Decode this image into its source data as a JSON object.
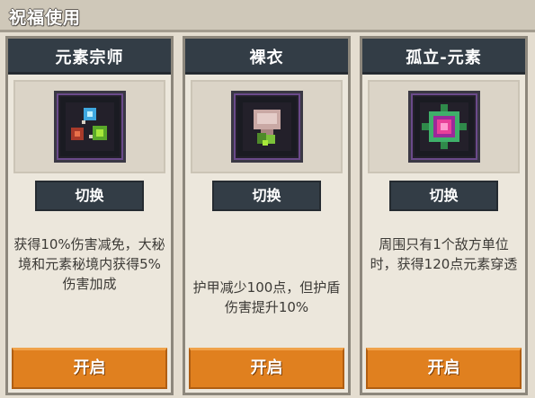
{
  "header": {
    "title": "祝福使用"
  },
  "cards": [
    {
      "name": "元素宗师",
      "icon": "elemental-master-icon",
      "switch_label": "切换",
      "description": "获得10%伤害减免，大秘境和元素秘境内获得5%伤害加成",
      "open_label": "开启"
    },
    {
      "name": "裸衣",
      "icon": "bare-armor-icon",
      "switch_label": "切换",
      "description": "护甲减少100点，但护盾伤害提升10%",
      "open_label": "开启"
    },
    {
      "name": "孤立-元素",
      "icon": "isolated-element-icon",
      "switch_label": "切换",
      "description": "周围只有1个敌方单位时，获得120点元素穿透",
      "open_label": "开启"
    }
  ],
  "colors": {
    "header_dark": "#333d46",
    "open_button": "#e0801f",
    "background": "#e4ddd0"
  }
}
